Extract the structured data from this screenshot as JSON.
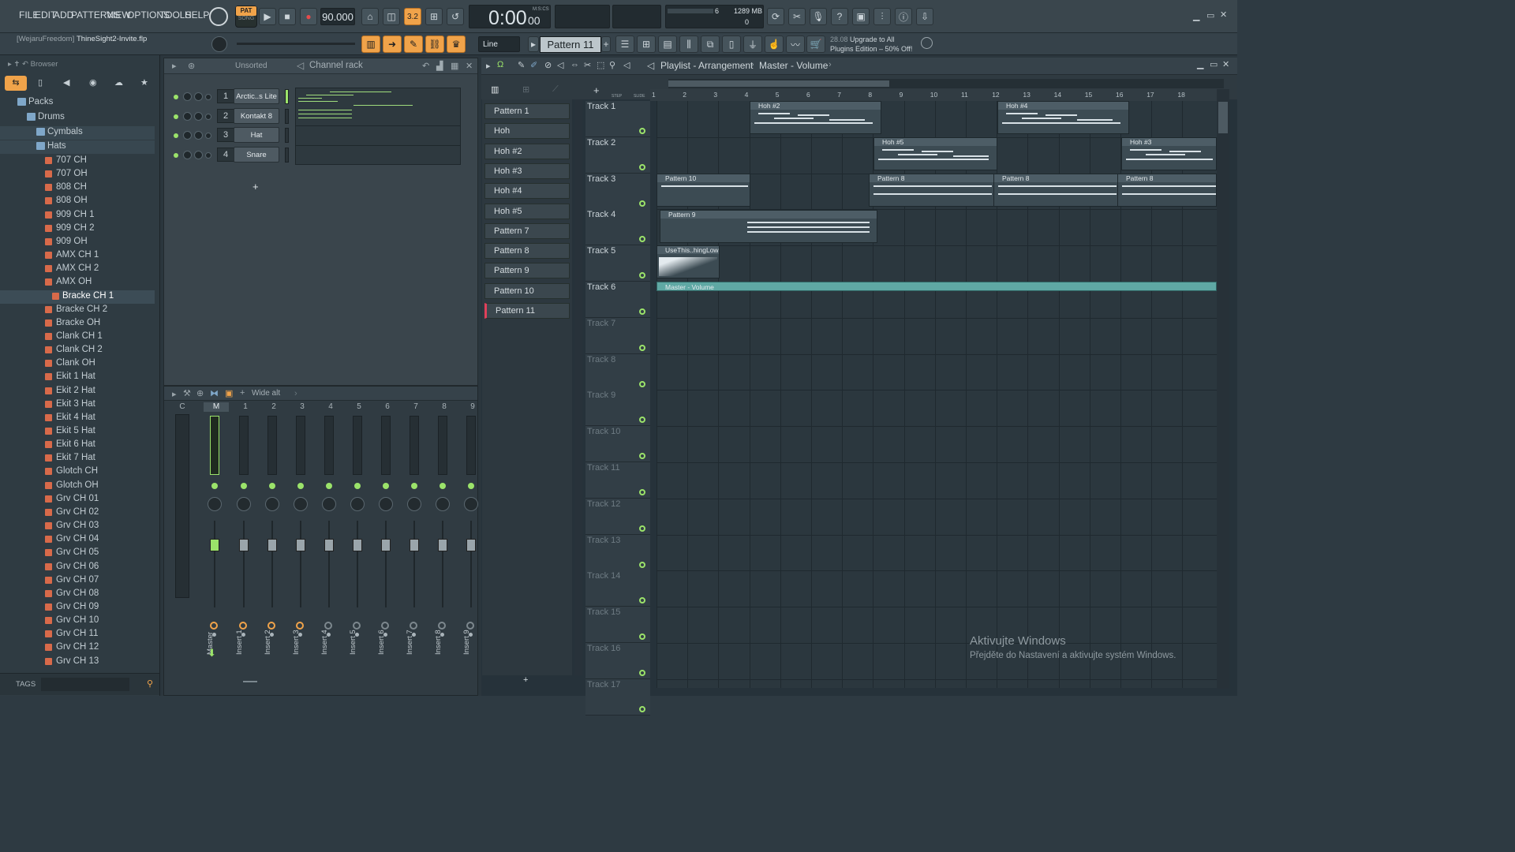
{
  "menu": [
    "FILE",
    "EDIT",
    "ADD",
    "PATTERNS",
    "VIEW",
    "OPTIONS",
    "TOOLS",
    "HELP"
  ],
  "transport": {
    "mode_top": "PAT",
    "mode_bottom": "SONG",
    "tempo": "90.000",
    "time": "0:00",
    "time_sub": "00",
    "time_unit": "M:S:CS",
    "cpu": "6",
    "ram": "1289 MB",
    "poly": "0",
    "snap_value": "3.2"
  },
  "project": {
    "title_user": "[WejaruFreedom]",
    "file": "ThineSight2-Invite.flp"
  },
  "pattern_selector": {
    "value": "Pattern 11",
    "snap": "Line"
  },
  "promo": {
    "version": "28.08",
    "line1": "Upgrade to All",
    "line2": "Plugins Edition – 50% Off!"
  },
  "browser": {
    "title": "Browser",
    "tree": [
      {
        "label": "Packs",
        "level": 0
      },
      {
        "label": "Drums",
        "level": 1
      },
      {
        "label": "Cymbals",
        "level": 2
      },
      {
        "label": "Hats",
        "level": 2
      }
    ],
    "items": [
      "707 CH",
      "707 OH",
      "808 CH",
      "808 OH",
      "909 CH 1",
      "909 CH 2",
      "909 OH",
      "AMX CH 1",
      "AMX CH 2",
      "AMX OH",
      "Bracke CH 1",
      "Bracke CH 2",
      "Bracke OH",
      "Clank CH 1",
      "Clank CH 2",
      "Clank OH",
      "Ekit 1 Hat",
      "Ekit 2 Hat",
      "Ekit 3 Hat",
      "Ekit 4 Hat",
      "Ekit 5 Hat",
      "Ekit 6 Hat",
      "Ekit 7 Hat",
      "Glotch CH",
      "Glotch OH",
      "Grv CH 01",
      "Grv CH 02",
      "Grv CH 03",
      "Grv CH 04",
      "Grv CH 05",
      "Grv CH 06",
      "Grv CH 07",
      "Grv CH 08",
      "Grv CH 09",
      "Grv CH 10",
      "Grv CH 11",
      "Grv CH 12",
      "Grv CH 13"
    ],
    "selected": "Bracke CH 1",
    "tags_label": "TAGS"
  },
  "channel_rack": {
    "title": "Channel rack",
    "filter": "Unsorted",
    "channels": [
      {
        "num": "1",
        "name": "Arctic..s Lite"
      },
      {
        "num": "2",
        "name": "Kontakt 8"
      },
      {
        "num": "3",
        "name": "Hat"
      },
      {
        "num": "4",
        "name": "Snare"
      }
    ],
    "add_label": "+"
  },
  "mixer": {
    "preset": "Wide alt",
    "headers": [
      "C",
      "M",
      "1",
      "2",
      "3",
      "4",
      "5",
      "6",
      "7",
      "8",
      "9"
    ],
    "inserts": [
      "Master",
      "Insert 1",
      "Insert 2",
      "Insert 3",
      "Insert 4",
      "Insert 5",
      "Insert 6",
      "Insert 7",
      "Insert 8",
      "Insert 9"
    ],
    "db_scale": [
      "3",
      "0",
      "3",
      "6",
      "9",
      "12",
      "15",
      "18",
      "21",
      "24",
      "27",
      "30",
      "33"
    ]
  },
  "playlist": {
    "breadcrumb": [
      "Playlist - Arrangement",
      "Master - Volume"
    ],
    "step_label": "STEP",
    "slide_label": "SLIDE",
    "patterns": [
      "Pattern 1",
      "Hoh",
      "Hoh #2",
      "Hoh #3",
      "Hoh #4",
      "Hoh #5",
      "Pattern 7",
      "Pattern 8",
      "Pattern 9",
      "Pattern 10",
      "Pattern 11"
    ],
    "ruler": [
      "1",
      "2",
      "3",
      "4",
      "5",
      "6",
      "7",
      "8",
      "9",
      "10",
      "11",
      "12",
      "13",
      "14",
      "15",
      "16",
      "17",
      "18"
    ],
    "tracks": [
      "Track 1",
      "Track 2",
      "Track 3",
      "Track 4",
      "Track 5",
      "Track 6",
      "Track 7",
      "Track 8",
      "Track 9",
      "Track 10",
      "Track 11",
      "Track 12",
      "Track 13",
      "Track 14",
      "Track 15",
      "Track 16",
      "Track 17"
    ],
    "clips": {
      "c1": "Hoh #2",
      "c2": "Hoh #4",
      "c3": "Hoh #5",
      "c4": "Hoh #3",
      "c5": "Pattern 10",
      "c6": "Pattern 8",
      "c7": "Pattern 8",
      "c8": "Pattern 8",
      "c9": "Pattern 9",
      "c10": "UseThis..hingLow",
      "c11": "Master - Volume"
    }
  },
  "watermark": {
    "line1": "Aktivujte Windows",
    "line2": "Přejděte do Nastavení a aktivujte systém Windows."
  },
  "colors": {
    "accent": "#f0a34a",
    "led": "#9be36a",
    "bg": "#2b363d"
  }
}
